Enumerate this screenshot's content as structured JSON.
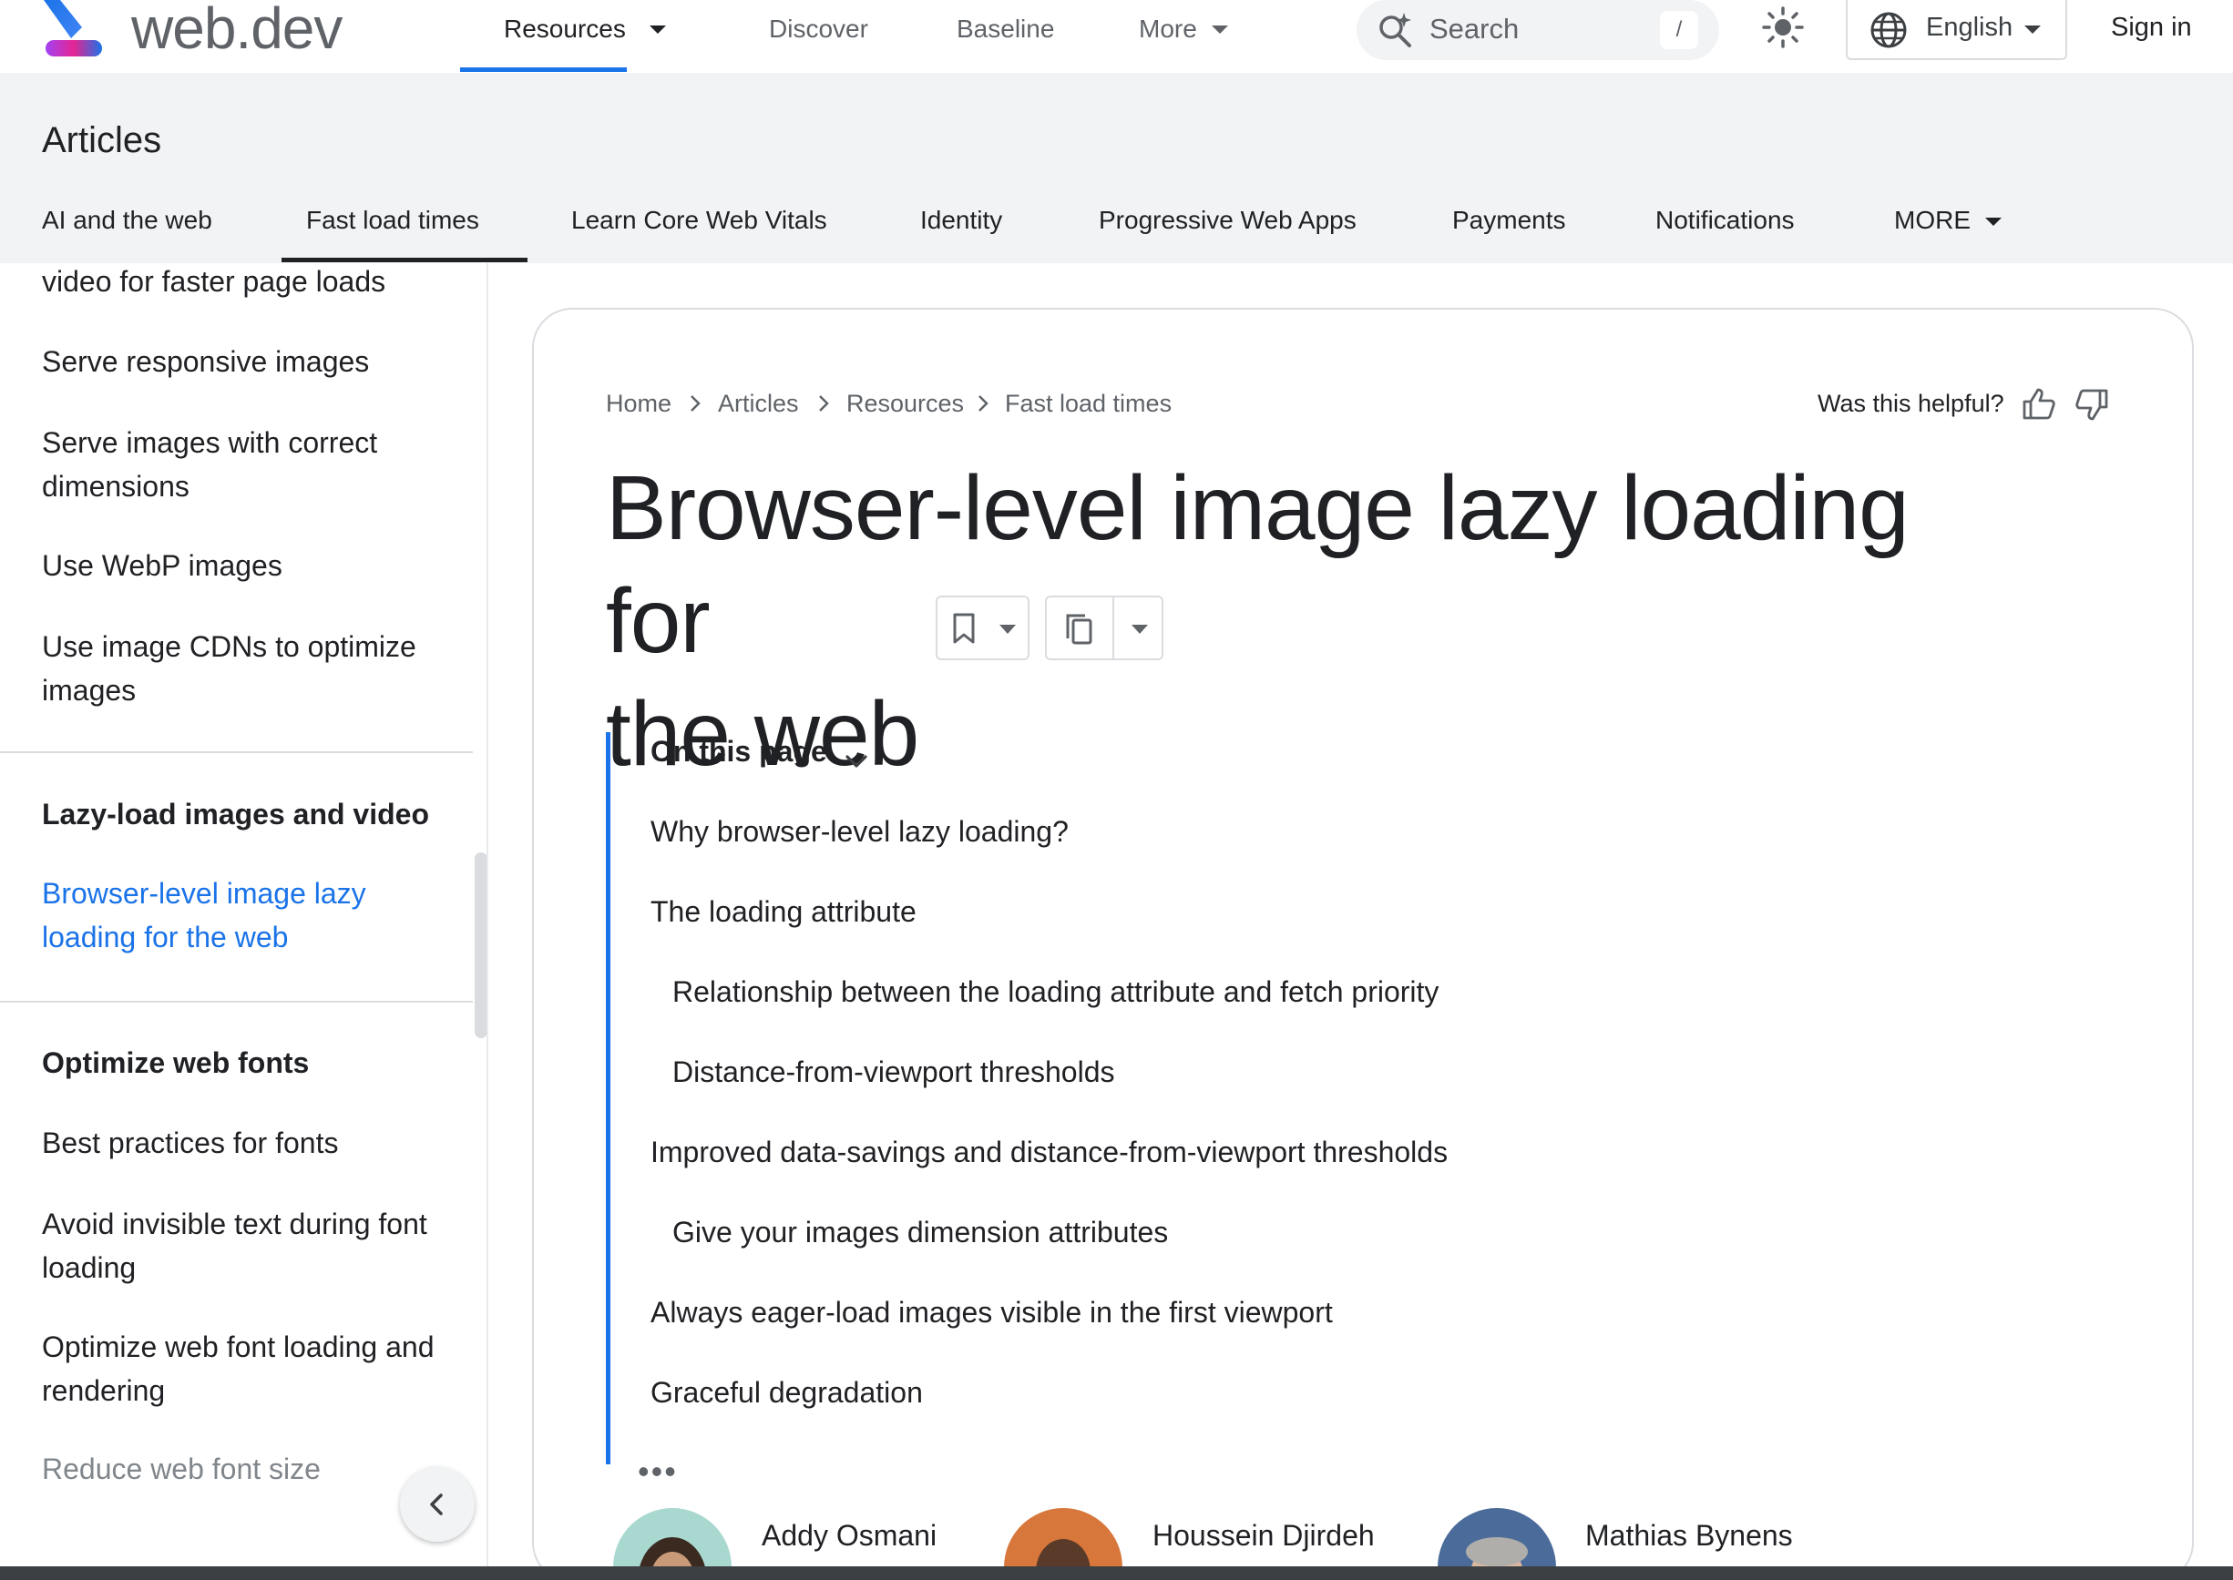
{
  "header": {
    "site_name": "web.dev",
    "nav": [
      {
        "label": "Resources",
        "active": true,
        "has_menu": true
      },
      {
        "label": "Discover",
        "active": false,
        "has_menu": false
      },
      {
        "label": "Baseline",
        "active": false,
        "has_menu": false
      },
      {
        "label": "More",
        "active": false,
        "has_menu": true
      }
    ],
    "search_placeholder": "Search",
    "search_shortcut": "/",
    "theme_icon": "sun-icon",
    "language": "English",
    "sign_in": "Sign in"
  },
  "subheader": {
    "title": "Articles",
    "tabs": [
      {
        "label": "AI and the web",
        "active": false
      },
      {
        "label": "Fast load times",
        "active": true
      },
      {
        "label": "Learn Core Web Vitals",
        "active": false
      },
      {
        "label": "Identity",
        "active": false
      },
      {
        "label": "Progressive Web Apps",
        "active": false
      },
      {
        "label": "Payments",
        "active": false
      },
      {
        "label": "Notifications",
        "active": false
      },
      {
        "label": "MORE",
        "active": false,
        "has_menu": true
      }
    ]
  },
  "sidebar": {
    "items": [
      {
        "label": "video for faster page loads"
      },
      {
        "label": "Serve responsive images"
      },
      {
        "label": "Serve images with correct dimensions"
      },
      {
        "label": "Use WebP images"
      },
      {
        "label": "Use image CDNs to optimize images"
      }
    ],
    "section_lazy": {
      "heading": "Lazy-load images and video",
      "items": [
        {
          "label": "Browser-level image lazy loading for the web",
          "active": true
        }
      ]
    },
    "section_fonts": {
      "heading": "Optimize web fonts",
      "items": [
        {
          "label": "Best practices for fonts"
        },
        {
          "label": "Avoid invisible text during font loading"
        },
        {
          "label": "Optimize web font loading and rendering"
        },
        {
          "label": "Reduce web font size"
        }
      ]
    }
  },
  "breadcrumb": [
    "Home",
    "Articles",
    "Resources",
    "Fast load times"
  ],
  "feedback": {
    "question": "Was this helpful?",
    "up_icon": "thumb-up-icon",
    "down_icon": "thumb-down-icon"
  },
  "article": {
    "title_line1": "Browser-level image lazy loading for",
    "title_line2": "the web"
  },
  "toc": {
    "heading": "On this page",
    "items": [
      {
        "label": "Why browser-level lazy loading?",
        "level": 1
      },
      {
        "label": "The loading attribute",
        "level": 1
      },
      {
        "label": "Relationship between the loading attribute and fetch priority",
        "level": 2
      },
      {
        "label": "Distance-from-viewport thresholds",
        "level": 2
      },
      {
        "label": "Improved data-savings and distance-from-viewport thresholds",
        "level": 1
      },
      {
        "label": "Give your images dimension attributes",
        "level": 2
      },
      {
        "label": "Always eager-load images visible in the first viewport",
        "level": 1
      },
      {
        "label": "Graceful degradation",
        "level": 1
      }
    ],
    "more": "•••"
  },
  "authors": [
    {
      "name": "Addy Osmani"
    },
    {
      "name": "Houssein Djirdeh"
    },
    {
      "name": "Mathias Bynens"
    }
  ],
  "colors": {
    "accent": "#1a73e8",
    "text": "#202124",
    "muted": "#5f6368",
    "subheader_bg": "#f1f3f4"
  }
}
